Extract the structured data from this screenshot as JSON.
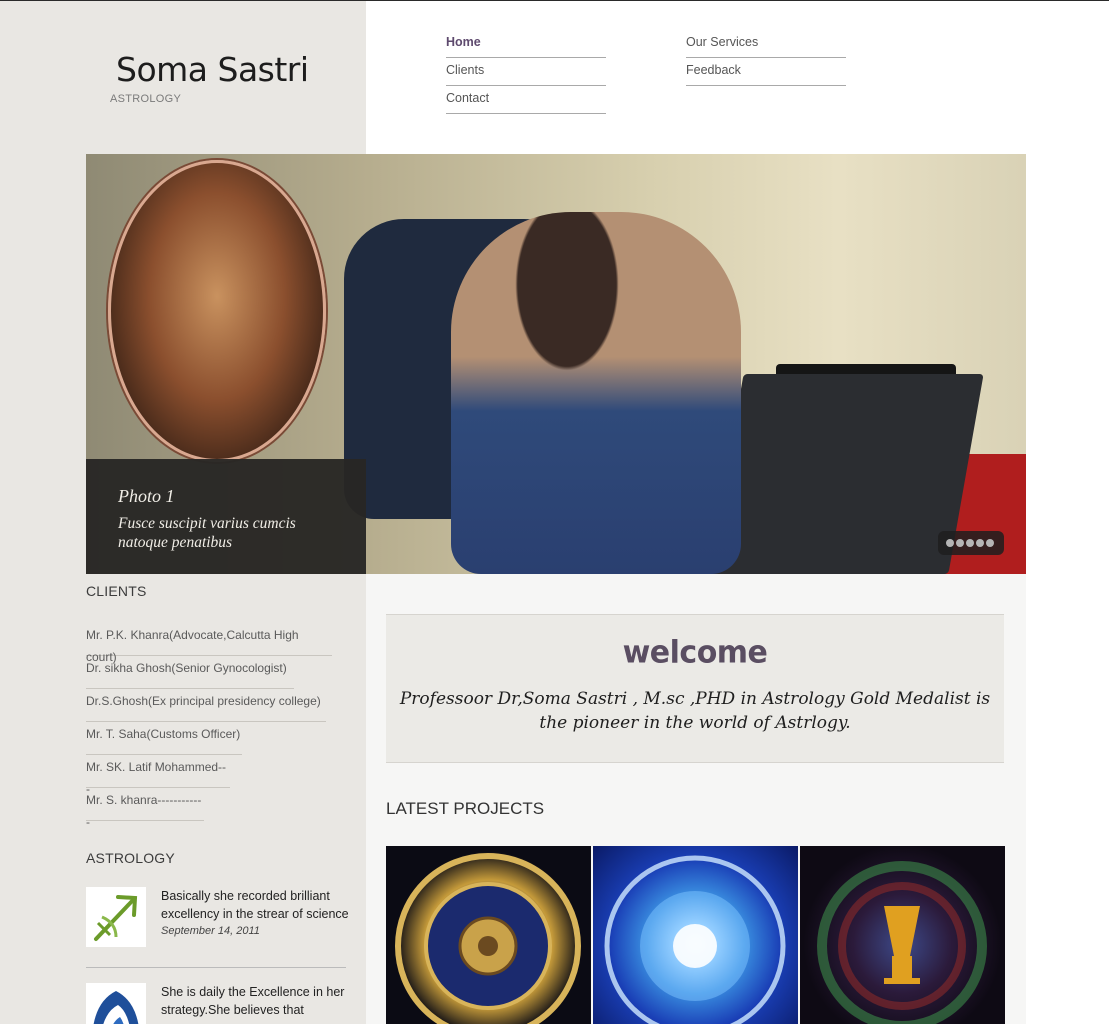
{
  "site": {
    "logo": "Soma Sastri",
    "tagline": "ASTROLOGY"
  },
  "nav": {
    "col1": [
      "Home",
      "Clients",
      "Contact"
    ],
    "col2": [
      "Our Services",
      "Feedback"
    ],
    "active": "Home"
  },
  "slider": {
    "caption_title": "Photo 1",
    "caption_text": "Fusce suscipit varius cumcis natoque penatibus",
    "dot_count": 5
  },
  "clients": {
    "heading": "CLIENTS",
    "items": [
      "Mr. P.K. Khanra(Advocate,Calcutta High court)",
      "Dr. sikha Ghosh(Senior Gynocologist)",
      "Dr.S.Ghosh(Ex principal presidency college)",
      "Mr. T. Saha(Customs Officer)",
      "Mr. SK. Latif Mohammed---",
      "Mr. S. khanra------------"
    ]
  },
  "astrology": {
    "heading": "ASTROLOGY",
    "posts": [
      {
        "text": "Basically she recorded brilliant excellency in the strear of science",
        "date": "September 14, 2011"
      },
      {
        "text": "She is daily the Excellence in her strategy.She believes that",
        "date": ""
      }
    ]
  },
  "welcome": {
    "title": "welcome",
    "text": "Professoor Dr,Soma Sastri , M.sc ,PHD in Astrology Gold Medalist is the pioneer in the world of Astrlogy."
  },
  "projects": {
    "heading": "LATEST PROJECTS"
  }
}
